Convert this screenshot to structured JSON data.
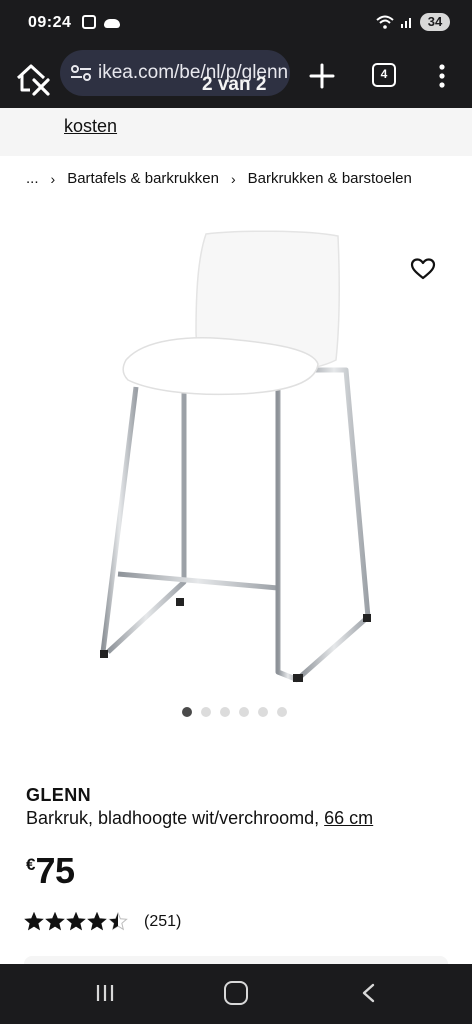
{
  "status_bar": {
    "time": "09:24",
    "battery": "34"
  },
  "browser": {
    "url": "ikea.com/be/nl/p/glenn",
    "tab_count": "4",
    "find_counter": "2 van 2"
  },
  "banner": {
    "link_text": "kosten"
  },
  "breadcrumb": {
    "items": [
      "...",
      "Bartafels & barkrukken",
      "Barkrukken & barstoelen"
    ]
  },
  "carousel": {
    "dot_count": 6,
    "active_index": 0
  },
  "product": {
    "name": "GLENN",
    "description": "Barkruk, bladhoogte wit/verchroomd,",
    "size_link": "66 cm",
    "currency": "€",
    "price": "75",
    "rating_value": 4.5,
    "rating_max": 5,
    "review_count": "(251)"
  },
  "icons": {
    "home": "home-close-icon",
    "tune": "tune-icon",
    "new_tab": "plus-icon",
    "tabs": "tabs-icon",
    "menu": "overflow-menu-icon",
    "wishlist": "heart-icon",
    "nav_recent": "recent-apps-icon",
    "nav_home": "home-nav-icon",
    "nav_back": "back-icon"
  },
  "colors": {
    "system_bar": "#1b1b1d",
    "url_bar": "#2e3142",
    "chrome_legs": "#b8bcc2",
    "star": "#111111"
  }
}
